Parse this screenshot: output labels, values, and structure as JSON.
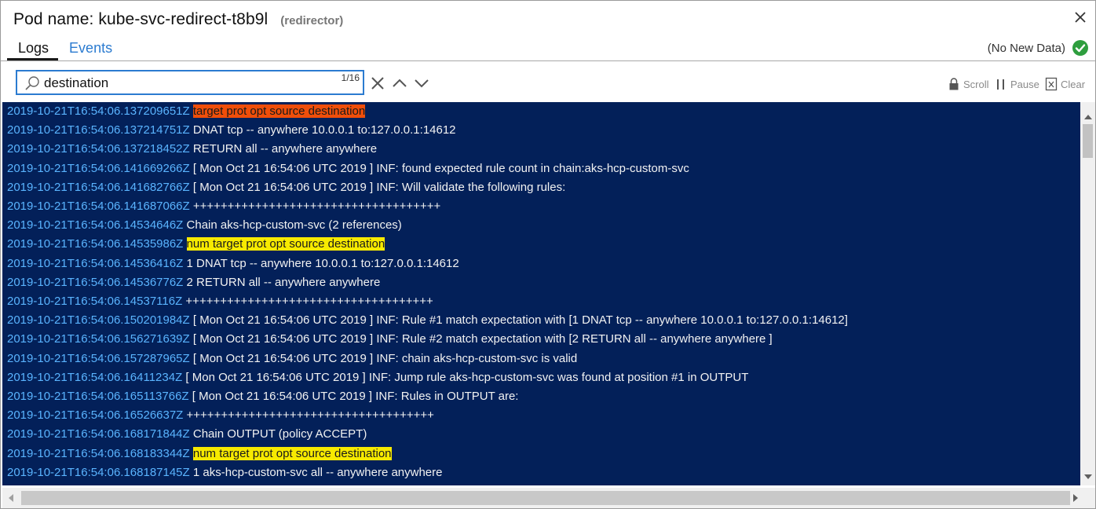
{
  "header": {
    "title": "Pod name: kube-svc-redirect-t8b9l",
    "subtitle": "(redirector)"
  },
  "tabs": [
    {
      "label": "Logs",
      "active": true
    },
    {
      "label": "Events",
      "active": false
    }
  ],
  "status": {
    "text": "(No New Data)",
    "icon": "check-circle-icon",
    "color": "#2e9e3e"
  },
  "search": {
    "value": "destination",
    "match_count": "1/16"
  },
  "toolbar": {
    "scroll_label": "Scroll",
    "pause_label": "Pause",
    "clear_label": "Clear"
  },
  "colors": {
    "log_background": "#032059",
    "timestamp": "#5ab4ff",
    "message": "#f2f2f2",
    "current_match": "#f04e0a",
    "other_match": "#f7ea00",
    "accent": "#2b7bd0"
  },
  "log_lines": [
    {
      "ts": "2019-10-21T16:54:06.137209651Z",
      "msg": "target prot opt source destination",
      "hl": "current"
    },
    {
      "ts": "2019-10-21T16:54:06.137214751Z",
      "msg": "DNAT tcp -- anywhere 10.0.0.1 to:127.0.0.1:14612",
      "hl": ""
    },
    {
      "ts": "2019-10-21T16:54:06.137218452Z",
      "msg": "RETURN all -- anywhere anywhere",
      "hl": ""
    },
    {
      "ts": "2019-10-21T16:54:06.141669266Z",
      "msg": "[ Mon Oct 21 16:54:06 UTC 2019 ] INF: found expected rule count in chain:aks-hcp-custom-svc",
      "hl": ""
    },
    {
      "ts": "2019-10-21T16:54:06.141682766Z",
      "msg": "[ Mon Oct 21 16:54:06 UTC 2019 ] INF: Will validate the following rules:",
      "hl": ""
    },
    {
      "ts": "2019-10-21T16:54:06.141687066Z",
      "msg": "++++++++++++++++++++++++++++++++++++",
      "hl": ""
    },
    {
      "ts": "2019-10-21T16:54:06.14534646Z",
      "msg": "Chain aks-hcp-custom-svc (2 references)",
      "hl": ""
    },
    {
      "ts": "2019-10-21T16:54:06.14535986Z",
      "msg": "num target prot opt source destination",
      "hl": "match"
    },
    {
      "ts": "2019-10-21T16:54:06.14536416Z",
      "msg": "1 DNAT tcp -- anywhere 10.0.0.1 to:127.0.0.1:14612",
      "hl": ""
    },
    {
      "ts": "2019-10-21T16:54:06.14536776Z",
      "msg": "2 RETURN all -- anywhere anywhere",
      "hl": ""
    },
    {
      "ts": "2019-10-21T16:54:06.14537116Z",
      "msg": "++++++++++++++++++++++++++++++++++++",
      "hl": ""
    },
    {
      "ts": "2019-10-21T16:54:06.150201984Z",
      "msg": "[ Mon Oct 21 16:54:06 UTC 2019 ] INF: Rule #1 match expectation with [1 DNAT tcp -- anywhere 10.0.0.1 to:127.0.0.1:14612]",
      "hl": ""
    },
    {
      "ts": "2019-10-21T16:54:06.156271639Z",
      "msg": "[ Mon Oct 21 16:54:06 UTC 2019 ] INF: Rule #2 match expectation with [2 RETURN all -- anywhere anywhere ]",
      "hl": ""
    },
    {
      "ts": "2019-10-21T16:54:06.157287965Z",
      "msg": "[ Mon Oct 21 16:54:06 UTC 2019 ] INF: chain aks-hcp-custom-svc is valid",
      "hl": ""
    },
    {
      "ts": "2019-10-21T16:54:06.16411234Z",
      "msg": "[ Mon Oct 21 16:54:06 UTC 2019 ] INF: Jump rule aks-hcp-custom-svc was found at position #1 in OUTPUT",
      "hl": ""
    },
    {
      "ts": "2019-10-21T16:54:06.165113766Z",
      "msg": "[ Mon Oct 21 16:54:06 UTC 2019 ] INF: Rules in OUTPUT are:",
      "hl": ""
    },
    {
      "ts": "2019-10-21T16:54:06.16526637Z",
      "msg": "++++++++++++++++++++++++++++++++++++",
      "hl": ""
    },
    {
      "ts": "2019-10-21T16:54:06.168171844Z",
      "msg": "Chain OUTPUT (policy ACCEPT)",
      "hl": ""
    },
    {
      "ts": "2019-10-21T16:54:06.168183344Z",
      "msg": "num target prot opt source destination",
      "hl": "match"
    },
    {
      "ts": "2019-10-21T16:54:06.168187145Z",
      "msg": "1 aks-hcp-custom-svc all -- anywhere anywhere",
      "hl": ""
    }
  ]
}
